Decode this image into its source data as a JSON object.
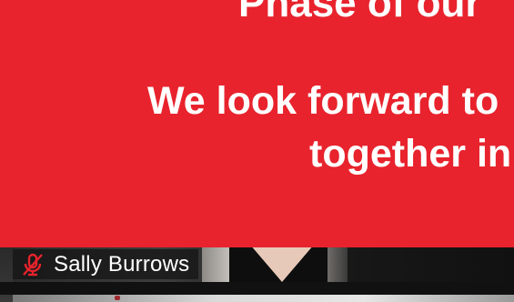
{
  "shared_screen": {
    "background_color": "#e8232d",
    "text_color": "#ffffff",
    "lines": [
      "Phase of our",
      "We look forward to",
      "together in"
    ]
  },
  "participant": {
    "name": "Sally Burrows",
    "mic_status": "muted",
    "mic_icon": "microphone-muted-icon",
    "mic_icon_color": "#e8232d"
  }
}
